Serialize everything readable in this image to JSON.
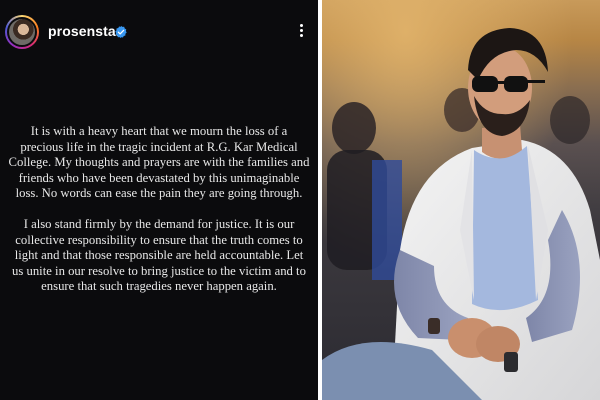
{
  "story": {
    "username": "prosenstar",
    "verified": true,
    "menu_icon": "more-vertical-icon",
    "paragraphs": [
      "It is with a heavy heart that we mourn the loss of a precious life in the tragic incident at R.G. Kar Medical College. My thoughts and prayers are with the families and friends who have been devastated by this unimaginable loss. No words can ease the pain they are going through.",
      "I also stand firmly by the demand for justice. It is our collective responsibility to ensure that the truth comes to light and that those responsible are held accountable. Let us unite in our resolve to bring justice to the victim and to ensure that such tragedies never happen again."
    ],
    "colors": {
      "background": "#0b0b0d",
      "text": "#e8e8e8",
      "verified": "#3897f0"
    }
  },
  "photo": {
    "subject": "man in sunglasses wearing white blazer and light blue t-shirt, seated at an event",
    "colors": {
      "blazer": "#ececec",
      "tshirt": "#9fb4dc",
      "background": "#3d3a3f"
    }
  }
}
